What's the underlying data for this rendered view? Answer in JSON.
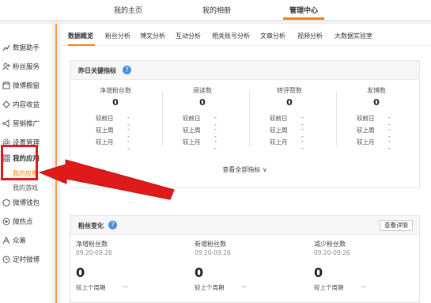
{
  "topnav": {
    "tabs": [
      {
        "label": "我的主页"
      },
      {
        "label": "我的相册"
      },
      {
        "label": "管理中心"
      }
    ]
  },
  "sidebar": {
    "items": [
      {
        "label": "数据助手",
        "icon": "chart-icon"
      },
      {
        "label": "粉丝服务",
        "icon": "fans-icon"
      },
      {
        "label": "微博橱窗",
        "icon": "shop-icon"
      },
      {
        "label": "内容收益",
        "icon": "coin-icon"
      },
      {
        "label": "营销推广",
        "icon": "promo-icon"
      },
      {
        "label": "设置管理",
        "icon": "gear-icon"
      },
      {
        "label": "我的应用",
        "icon": "grid-icon"
      },
      {
        "label": "微博钱包",
        "icon": "wallet-icon"
      },
      {
        "label": "微热点",
        "icon": "hot-icon"
      },
      {
        "label": "众筹",
        "icon": "crowd-icon"
      },
      {
        "label": "定时微博",
        "icon": "clock-icon"
      }
    ],
    "subitems": [
      {
        "label": "我的应用"
      },
      {
        "label": "我的游戏"
      }
    ]
  },
  "subtabs": [
    "数据概览",
    "粉丝分析",
    "博文分析",
    "互动分析",
    "相关账号分析",
    "文章分析",
    "视频分析",
    "大数据实验室"
  ],
  "overview": {
    "title": "昨日关键指标",
    "metrics": [
      {
        "label": "净增粉丝数",
        "value": "0",
        "rows": [
          {
            "k": "较前日",
            "v": "--"
          },
          {
            "k": "较上周",
            "v": "--"
          },
          {
            "k": "较上月",
            "v": "--"
          }
        ]
      },
      {
        "label": "阅读数",
        "value": "0",
        "rows": [
          {
            "k": "较前日",
            "v": "--"
          },
          {
            "k": "较上周",
            "v": "--"
          },
          {
            "k": "较上月",
            "v": "--"
          }
        ]
      },
      {
        "label": "转评赞数",
        "value": "0",
        "rows": [
          {
            "k": "较前日",
            "v": "--"
          },
          {
            "k": "较上周",
            "v": "--"
          },
          {
            "k": "较上月",
            "v": "--"
          }
        ]
      },
      {
        "label": "发博数",
        "value": "0",
        "rows": [
          {
            "k": "较前日",
            "v": "--"
          },
          {
            "k": "较上周",
            "v": "--"
          },
          {
            "k": "较上月",
            "v": "--"
          }
        ]
      }
    ],
    "view_all": "查看全部指标 ∨"
  },
  "fans": {
    "title": "粉丝变化",
    "detail_button": "查看详情",
    "cols": [
      {
        "label": "净增粉丝数",
        "date": "09.20-09.26",
        "value": "0",
        "prev": "较上个周期",
        "prev_v": "--"
      },
      {
        "label": "新增粉丝数",
        "date": "09.20-09.26",
        "value": "0",
        "prev": "较上个周期",
        "prev_v": "--"
      },
      {
        "label": "减少粉丝数",
        "date": "09.20-09.26",
        "value": "0",
        "prev": "较上个周期",
        "prev_v": "--"
      }
    ]
  },
  "colors": {
    "accent": "#ff8200",
    "highlight": "#e01a1a",
    "help": "#4a8fd9"
  }
}
